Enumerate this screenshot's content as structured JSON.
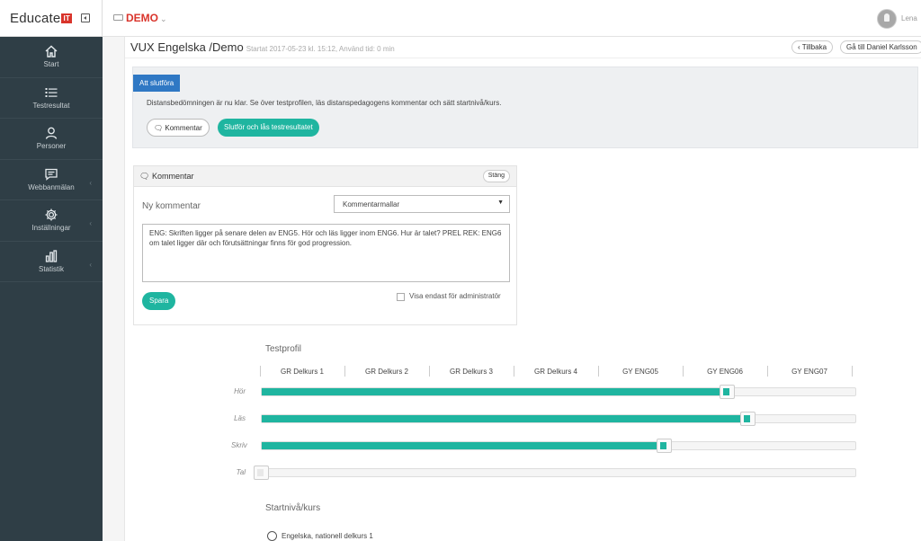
{
  "brand": {
    "logo_text": "Educate",
    "logo_badge": "IT"
  },
  "sidebar": {
    "items": [
      {
        "label": "Start",
        "icon": "home-icon",
        "chevron": false
      },
      {
        "label": "Testresultat",
        "icon": "list-icon",
        "chevron": false
      },
      {
        "label": "Personer",
        "icon": "people-icon",
        "chevron": false
      },
      {
        "label": "Webbanmälan",
        "icon": "message-icon",
        "chevron": true
      },
      {
        "label": "Inställningar",
        "icon": "gear-icon",
        "chevron": true
      },
      {
        "label": "Statistik",
        "icon": "bar-chart-icon",
        "chevron": true
      }
    ]
  },
  "topbar": {
    "org": "DEMO",
    "user": "Lena"
  },
  "page": {
    "title": "VUX Engelska /Demo",
    "subtitle": "Startat 2017-05-23 kl. 15:12, Använd tid: 0 min",
    "back_label": "Tillbaka",
    "goto_label": "Gå till Daniel Karlsson"
  },
  "alert": {
    "tab_label": "Att slutföra",
    "text": "Distansbedömningen är nu klar. Se över testprofilen, läs distanspedagogens kommentar och sätt startnivå/kurs.",
    "comment_button": "Kommentar",
    "finish_button": "Slutför och lås testresultatet"
  },
  "comment_panel": {
    "title": "Kommentar",
    "close_label": "Stäng",
    "new_label": "Ny kommentar",
    "template_select": "Kommentarmallar",
    "text": "ENG: Skriften ligger på senare delen av ENG5. Hör och läs ligger inom ENG6. Hur är talet? PREL REK: ENG6 om talet ligger där och förutsättningar finns för god progression.",
    "save_label": "Spara",
    "admin_only_label": "Visa endast för administratör"
  },
  "profile": {
    "title": "Testprofil",
    "levels": [
      "GR Delkurs 1",
      "GR Delkurs 2",
      "GR Delkurs 3",
      "GR Delkurs 4",
      "GY ENG05",
      "GY ENG06",
      "GY ENG07"
    ],
    "skills": [
      {
        "label": "Hör",
        "value_percent": 78.5
      },
      {
        "label": "Läs",
        "value_percent": 81.9
      },
      {
        "label": "Skriv",
        "value_percent": 67.9
      },
      {
        "label": "Tal",
        "value_percent": 0
      }
    ]
  },
  "start_level": {
    "title": "Startnivå/kurs",
    "options": [
      "Engelska, nationell delkurs 1"
    ]
  },
  "colors": {
    "accent": "#1fb5a0",
    "brand_red": "#d9342b",
    "sidebar": "#2f3e46",
    "primary_blue": "#2f78c4"
  }
}
